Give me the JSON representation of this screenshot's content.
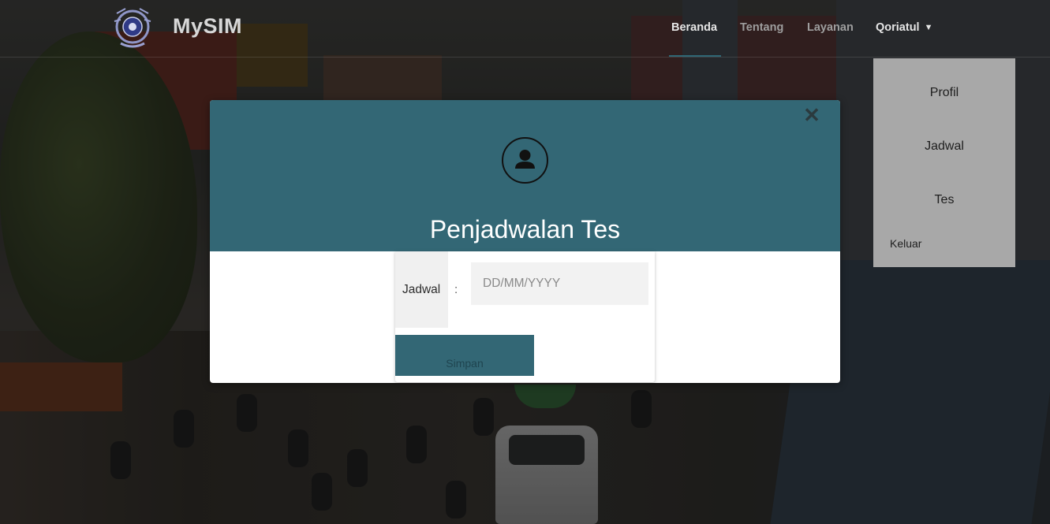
{
  "navbar": {
    "brand": "MySIM",
    "items": [
      {
        "label": "Beranda",
        "active": true
      },
      {
        "label": "Tentang",
        "active": false
      },
      {
        "label": "Layanan",
        "active": false
      }
    ],
    "user": {
      "label": "Qoriatul",
      "icon": "chevron-down-icon"
    }
  },
  "dropdown": {
    "items": [
      "Profil",
      "Jadwal",
      "Tes"
    ],
    "logout": "Keluar"
  },
  "modal": {
    "title": "Penjadwalan Tes",
    "close_icon": "close-icon",
    "header_icon": "user-icon",
    "form": {
      "label": "Jadwal",
      "separator": ":",
      "placeholder": "DD/MM/YYYY",
      "value": "",
      "submit": "Simpan"
    }
  },
  "colors": {
    "accent": "#336775",
    "dropdown_bg": "#a8a8a8"
  }
}
